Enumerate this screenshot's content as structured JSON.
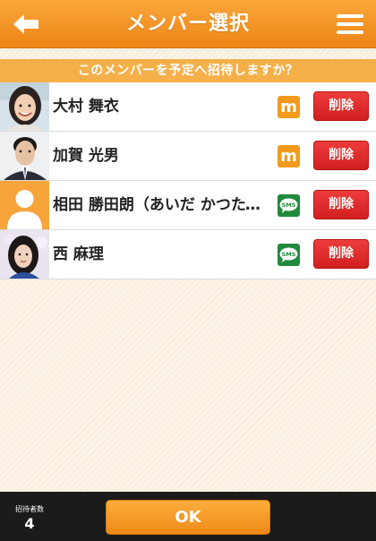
{
  "header": {
    "title": "メンバー選択",
    "back_icon": "back-arrow-icon",
    "menu_icon": "hamburger-menu-icon"
  },
  "question": "このメンバーを予定へ招待しますか？",
  "members": [
    {
      "name": "大村 舞衣",
      "badge": "m",
      "delete_label": "削除"
    },
    {
      "name": "加賀 光男",
      "badge": "m",
      "delete_label": "削除"
    },
    {
      "name": "相田 勝田朗（あいだ かつたろう）",
      "badge": "SMS",
      "delete_label": "削除"
    },
    {
      "name": "西 麻理",
      "badge": "SMS",
      "delete_label": "削除"
    }
  ],
  "footer": {
    "count_label": "招待者数",
    "count_value": "4",
    "ok_label": "OK"
  },
  "colors": {
    "header": "#f39427",
    "question_bar": "#f6b04a",
    "delete_button": "#e02b2b",
    "mail_badge": "#f19a1c",
    "sms_badge": "#1f8a3c",
    "footer": "#1b1b1b"
  }
}
